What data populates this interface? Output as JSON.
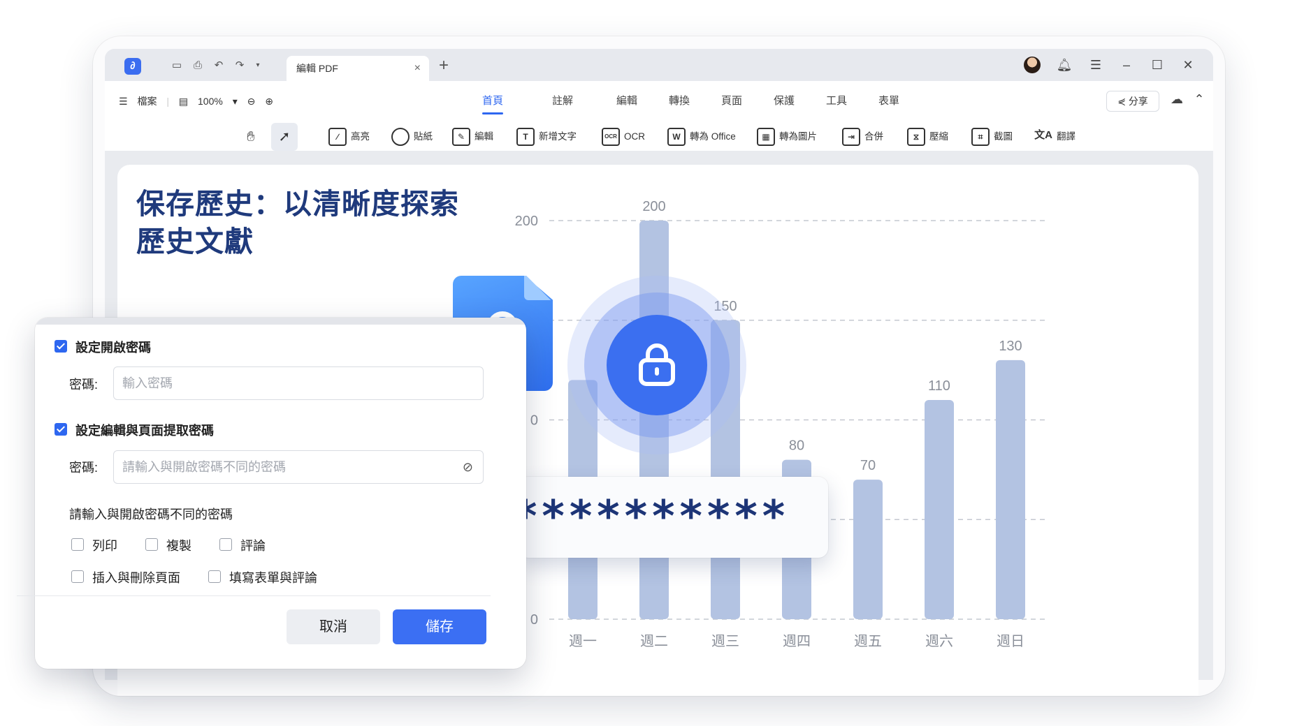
{
  "window": {
    "tab_title": "編輯 PDF",
    "tab_close": "×",
    "new_tab": "+"
  },
  "menubar": {
    "file": "檔案",
    "zoom": "100%",
    "share": "分享"
  },
  "nav_tabs": [
    "首頁",
    "註解",
    "編輯",
    "轉換",
    "頁面",
    "保護",
    "工具",
    "表單"
  ],
  "tools": [
    {
      "label": "高亮",
      "icon": "highlight-icon"
    },
    {
      "label": "貼紙",
      "icon": "sticker-icon"
    },
    {
      "label": "編輯",
      "icon": "edit-icon"
    },
    {
      "label": "新增文字",
      "icon": "add-text-icon"
    },
    {
      "label": "OCR",
      "icon": "ocr-icon"
    },
    {
      "label": "轉為 Office",
      "icon": "to-office-icon"
    },
    {
      "label": "轉為圖片",
      "icon": "to-image-icon"
    },
    {
      "label": "合併",
      "icon": "merge-icon"
    },
    {
      "label": "壓縮",
      "icon": "compress-icon"
    },
    {
      "label": "截圖",
      "icon": "screenshot-icon"
    },
    {
      "label": "翻譯",
      "icon": "translate-icon"
    }
  ],
  "document": {
    "title_line1": "保存歷史：以清晰度探索",
    "title_line2": "歷史文獻"
  },
  "chart_data": {
    "type": "bar",
    "categories": [
      "週一",
      "週二",
      "週三",
      "週四",
      "週五",
      "週六",
      "週日"
    ],
    "values": [
      120,
      200,
      150,
      80,
      70,
      110,
      130
    ],
    "value_labels": [
      "",
      "200",
      "150",
      "80",
      "70",
      "110",
      "130"
    ],
    "y_tick_labels": [
      "0",
      "0",
      "",
      "200"
    ],
    "ylim": [
      0,
      200
    ],
    "bar_color": "#b3c3e2",
    "grid": "dashed"
  },
  "password_overlay": {
    "masked_text": "**********"
  },
  "dialog": {
    "open_password_label": "設定開啟密碼",
    "password_label": "密碼:",
    "open_password_placeholder": "輸入密碼",
    "edit_password_label": "設定編輯與頁面提取密碼",
    "edit_password_placeholder": "請輸入與開啟密碼不同的密碼",
    "hint": "請輸入與開啟密碼不同的密碼",
    "permissions": [
      "列印",
      "複製",
      "評論",
      "插入與刪除頁面",
      "填寫表單與評論"
    ],
    "cancel": "取消",
    "save": "儲存"
  },
  "colors": {
    "accent": "#2e67f0",
    "title": "#1f3a7c",
    "bars": "#b3c3e2"
  }
}
